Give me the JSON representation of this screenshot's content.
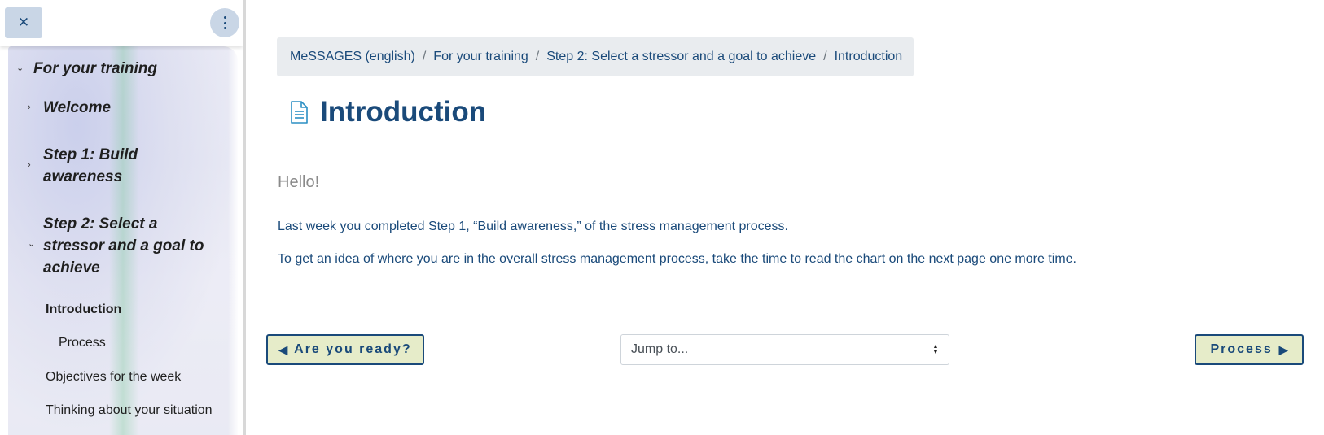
{
  "sidebar": {
    "close_icon": "close-icon",
    "menu_icon": "vertical-dots-icon",
    "section": {
      "label": "For your training",
      "icon": "chevron-down-icon"
    },
    "items": [
      {
        "label": "Welcome",
        "icon": "chevron-right-icon"
      },
      {
        "label": "Step 1: Build awareness",
        "icon": "chevron-right-icon"
      },
      {
        "label": "Step 2: Select a stressor and a goal to achieve",
        "icon": "chevron-down-icon"
      }
    ],
    "leaves": [
      {
        "label": "Introduction",
        "active": true
      },
      {
        "label": "Process"
      },
      {
        "label": "Objectives for the week"
      },
      {
        "label": "Thinking about your situation"
      }
    ]
  },
  "breadcrumb": {
    "items": [
      "MeSSAGES (english)",
      "For your training",
      "Step 2: Select a stressor and a goal to achieve",
      "Introduction"
    ],
    "separator": "/"
  },
  "main": {
    "icon": "document-icon",
    "title": "Introduction",
    "greeting": "Hello!",
    "paragraphs": [
      "Last week you completed Step 1, “Build awareness,” of the stress management process.",
      "To get an idea of where you are in the overall stress management process, take the time to read the chart on the next page one more time."
    ]
  },
  "navigation": {
    "prev_label": "Are you ready?",
    "prev_icon": "◀",
    "next_label": "Process",
    "next_icon": "▶",
    "jump_placeholder": "Jump to..."
  },
  "colors": {
    "brand": "#1a4a7a",
    "button_bg": "#e6ecc9",
    "breadcrumb_bg": "#e9ecef",
    "close_bg": "#c9d6e6"
  }
}
